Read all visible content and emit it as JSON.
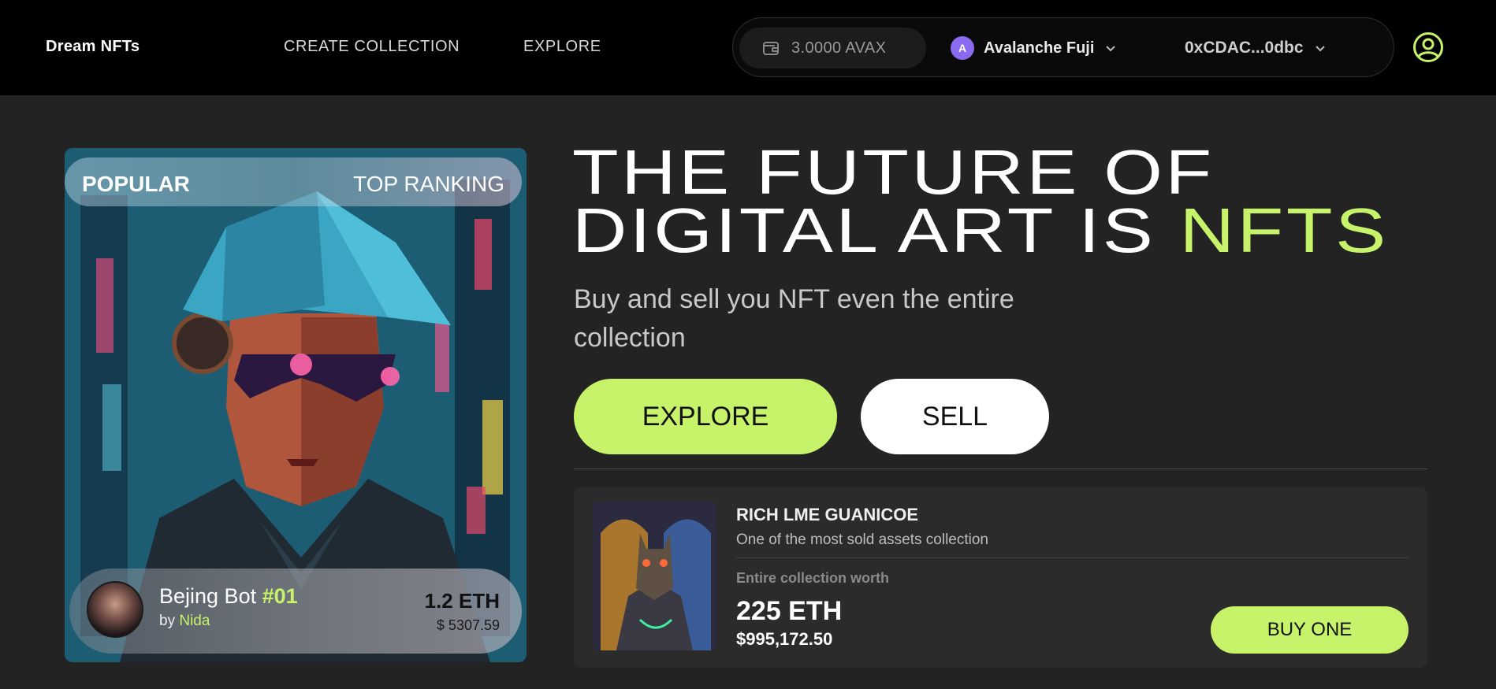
{
  "header": {
    "brand": "Dream NFTs",
    "nav": {
      "create": "CREATE COLLECTION",
      "explore": "EXPLORE"
    },
    "wallet": {
      "balance": "3.0000 AVAX",
      "network_badge": "A",
      "network": "Avalanche Fuji",
      "address": "0xCDAC...0dbc"
    }
  },
  "hero_card": {
    "popular": "POPULAR",
    "top_ranking": "TOP RANKING",
    "nft_name": "Bejing Bot",
    "nft_number": "#01",
    "by_label": "by",
    "creator": "Nida",
    "price_eth": "1.2 ETH",
    "price_usd": "$ 5307.59"
  },
  "hero": {
    "headline_1": "THE FUTURE OF",
    "headline_2": "DIGITAL ART IS",
    "headline_accent": "NFTS",
    "subtitle": "Buy and sell you NFT even the entire collection",
    "explore_button": "EXPLORE",
    "sell_button": "SELL"
  },
  "collection": {
    "title": "RICH LME GUANICOE",
    "description": "One of the most sold assets collection",
    "worth_label": "Entire collection worth",
    "worth_eth": "225 ETH",
    "worth_usd": "$995,172.50",
    "buy_button": "BUY ONE"
  },
  "colors": {
    "accent": "#c6f36a",
    "background": "#232323",
    "header_bg": "#000000",
    "network_badge": "#8a6bf0"
  },
  "icons": [
    "wallet-icon",
    "chevron-down-icon",
    "user-circle-icon"
  ]
}
